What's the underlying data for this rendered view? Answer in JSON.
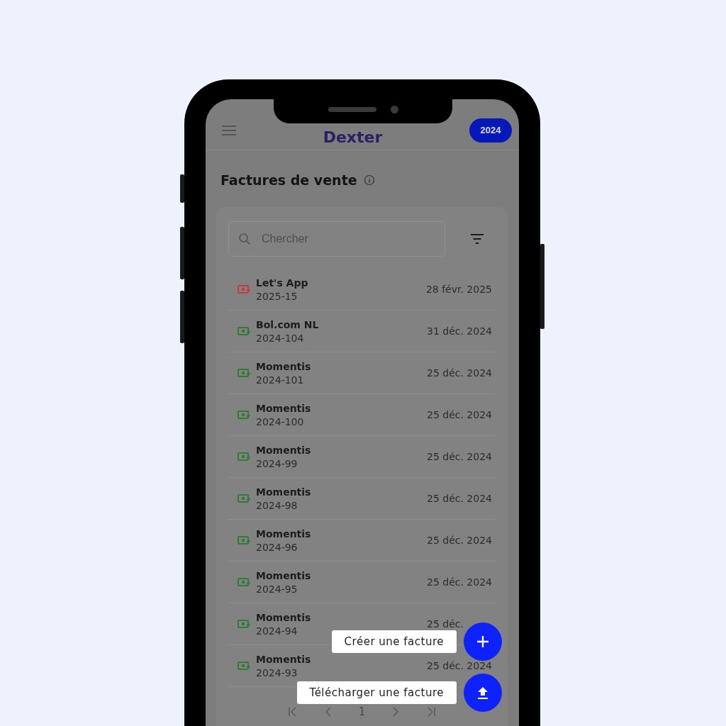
{
  "header": {
    "logo": "Dexter",
    "year": "2024"
  },
  "page": {
    "title": "Factures de vente"
  },
  "search": {
    "placeholder": "Chercher"
  },
  "invoices": [
    {
      "client": "Let's App",
      "number": "2025-15",
      "date": "28 févr. 2025",
      "color": "#c83a3a"
    },
    {
      "client": "Bol.com NL",
      "number": "2024-104",
      "date": "31 déc. 2024",
      "color": "#2e7d32"
    },
    {
      "client": "Momentis",
      "number": "2024-101",
      "date": "25 déc. 2024",
      "color": "#2e7d32"
    },
    {
      "client": "Momentis",
      "number": "2024-100",
      "date": "25 déc. 2024",
      "color": "#2e7d32"
    },
    {
      "client": "Momentis",
      "number": "2024-99",
      "date": "25 déc. 2024",
      "color": "#2e7d32"
    },
    {
      "client": "Momentis",
      "number": "2024-98",
      "date": "25 déc. 2024",
      "color": "#2e7d32"
    },
    {
      "client": "Momentis",
      "number": "2024-96",
      "date": "25 déc. 2024",
      "color": "#2e7d32"
    },
    {
      "client": "Momentis",
      "number": "2024-95",
      "date": "25 déc. 2024",
      "color": "#2e7d32"
    },
    {
      "client": "Momentis",
      "number": "2024-94",
      "date": "25 déc.",
      "color": "#2e7d32"
    },
    {
      "client": "Momentis",
      "number": "2024-93",
      "date": "25 déc. 2024",
      "color": "#2e7d32"
    }
  ],
  "pagination": {
    "page": "1"
  },
  "actions": [
    {
      "kind": "create",
      "label": "Créer une facture"
    },
    {
      "kind": "upload",
      "label": "Télécharger une facture"
    }
  ]
}
